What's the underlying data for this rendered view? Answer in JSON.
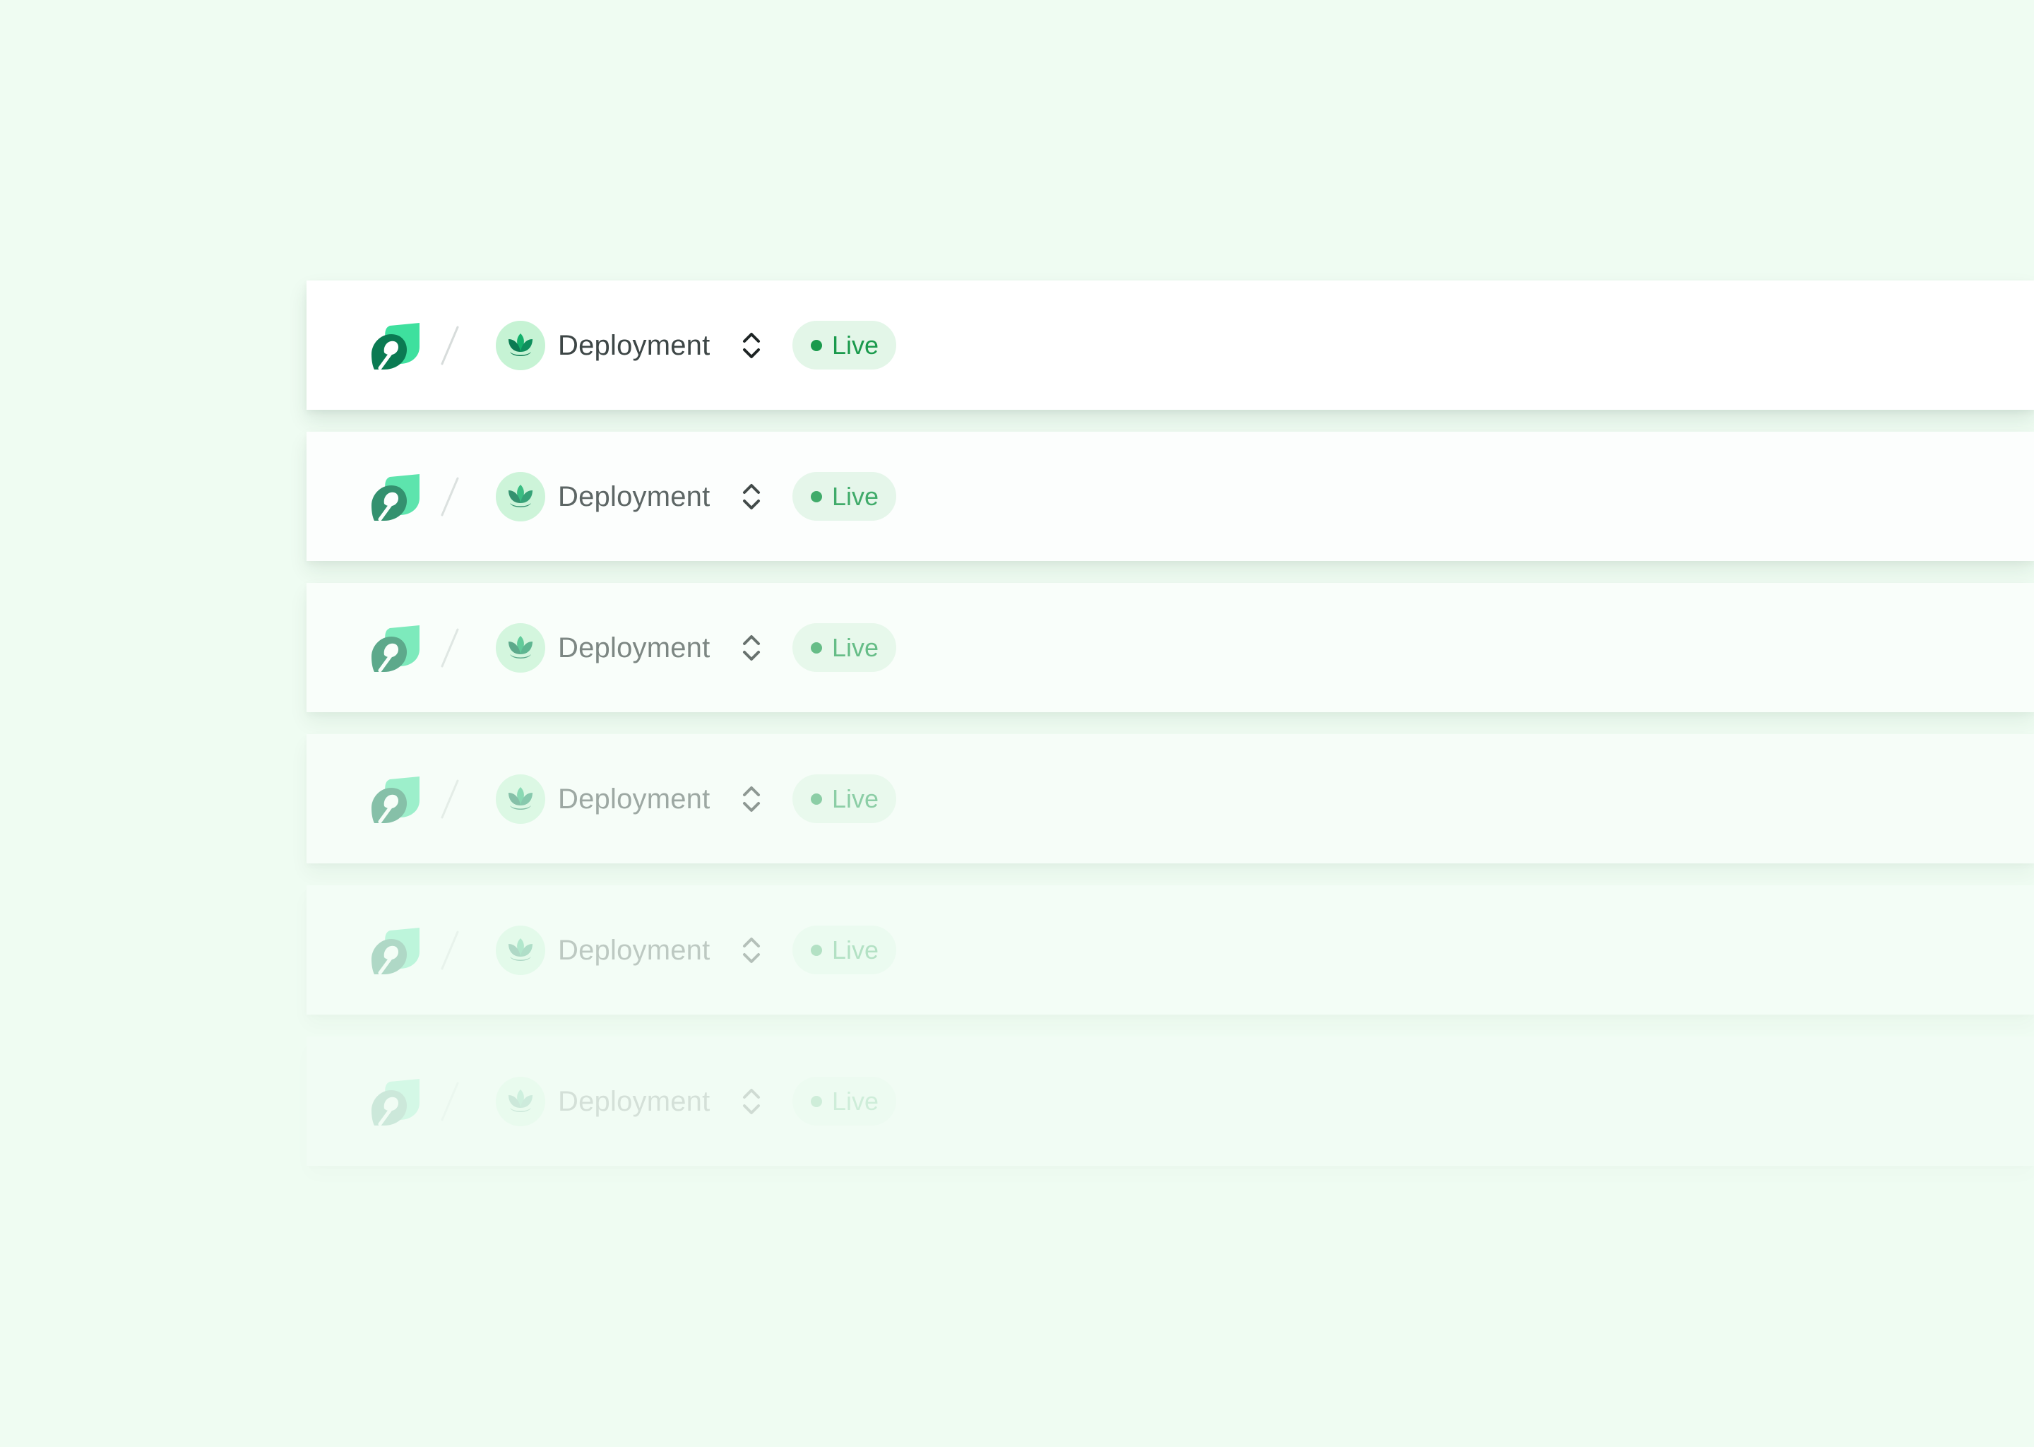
{
  "colors": {
    "background": "#effcf2",
    "bar": "#ffffff",
    "logo_light": "#3ee09e",
    "logo_dark": "#0b7a52",
    "avatar_bg": "#c6f3d4",
    "status_bg": "#e3f6e8",
    "status_text": "#1a9a4c",
    "project_text": "#3d4646"
  },
  "bars": [
    {
      "fade": 0.0,
      "logo_icon": "leaf-logo-icon",
      "divider": "/",
      "project_icon": "lotus-icon",
      "project_name": "Deployment",
      "switcher_icon": "chevron-up-down-icon",
      "status_label": "Live"
    },
    {
      "fade": 0.18,
      "logo_icon": "leaf-logo-icon",
      "divider": "/",
      "project_icon": "lotus-icon",
      "project_name": "Deployment",
      "switcher_icon": "chevron-up-down-icon",
      "status_label": "Live"
    },
    {
      "fade": 0.36,
      "logo_icon": "leaf-logo-icon",
      "divider": "/",
      "project_icon": "lotus-icon",
      "project_name": "Deployment",
      "switcher_icon": "chevron-up-down-icon",
      "status_label": "Live"
    },
    {
      "fade": 0.54,
      "logo_icon": "leaf-logo-icon",
      "divider": "/",
      "project_icon": "lotus-icon",
      "project_name": "Deployment",
      "switcher_icon": "chevron-up-down-icon",
      "status_label": "Live"
    },
    {
      "fade": 0.72,
      "logo_icon": "leaf-logo-icon",
      "divider": "/",
      "project_icon": "lotus-icon",
      "project_name": "Deployment",
      "switcher_icon": "chevron-up-down-icon",
      "status_label": "Live"
    },
    {
      "fade": 0.85,
      "logo_icon": "leaf-logo-icon",
      "divider": "/",
      "project_icon": "lotus-icon",
      "project_name": "Deployment",
      "switcher_icon": "chevron-up-down-icon",
      "status_label": "Live"
    }
  ]
}
